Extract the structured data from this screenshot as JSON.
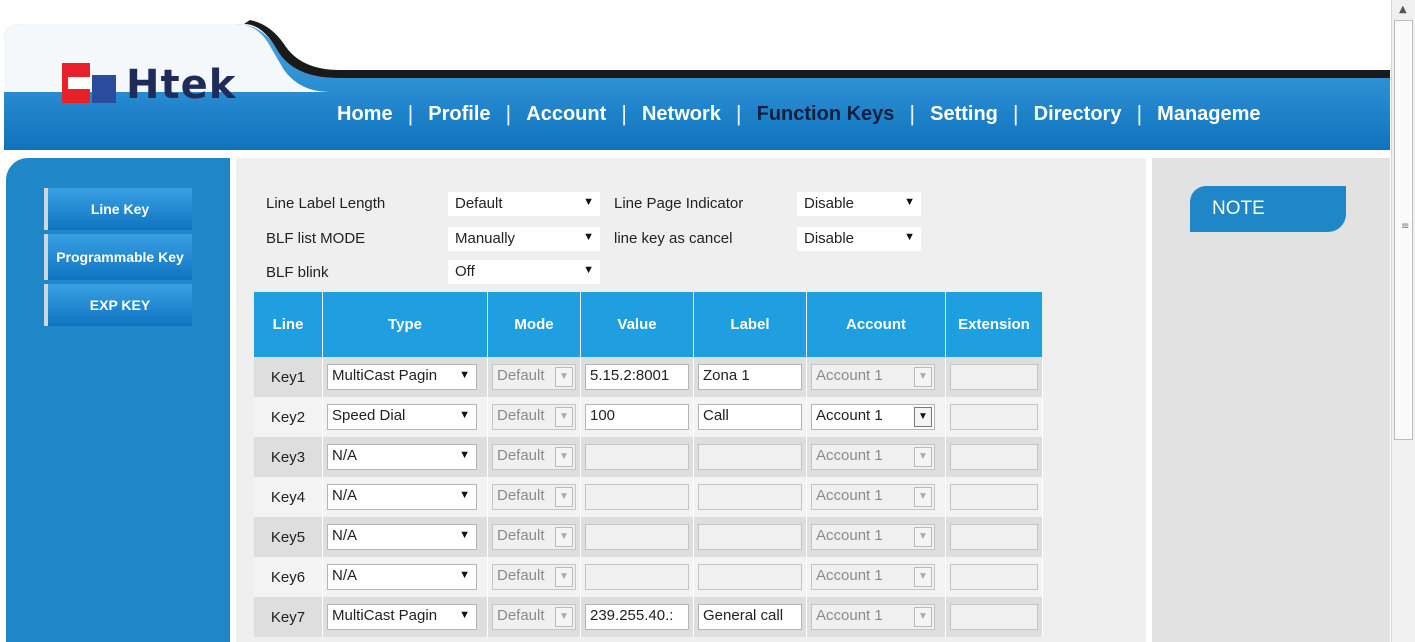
{
  "brand": {
    "logo_text": "Htek"
  },
  "nav": {
    "items": [
      "Home",
      "Profile",
      "Account",
      "Network",
      "Function Keys",
      "Setting",
      "Directory",
      "Manageme"
    ],
    "separator": "|",
    "active": "Function Keys"
  },
  "sidebar": {
    "items": [
      {
        "label": "Line Key"
      },
      {
        "label": "Programmable Key"
      },
      {
        "label": "EXP KEY"
      }
    ]
  },
  "settings": {
    "line_label_length": {
      "label": "Line Label Length",
      "value": "Default"
    },
    "line_page_indicator": {
      "label": "Line Page Indicator",
      "value": "Disable"
    },
    "blf_list_mode": {
      "label": "BLF list MODE",
      "value": "Manually"
    },
    "line_key_as_cancel": {
      "label": "line key as cancel",
      "value": "Disable"
    },
    "blf_blink": {
      "label": "BLF blink",
      "value": "Off"
    }
  },
  "table": {
    "headers": [
      "Line",
      "Type",
      "Mode",
      "Value",
      "Label",
      "Account",
      "Extension"
    ],
    "rows": [
      {
        "line": "Key1",
        "type": "MultiCast Pagin",
        "mode": "Default",
        "value": "5.15.2:8001",
        "label": "Zona 1",
        "account": "Account 1",
        "extension": ""
      },
      {
        "line": "Key2",
        "type": "Speed Dial",
        "mode": "Default",
        "value": "100",
        "label": "Call",
        "account": "Account 1",
        "extension": ""
      },
      {
        "line": "Key3",
        "type": "N/A",
        "mode": "Default",
        "value": "",
        "label": "",
        "account": "Account 1",
        "extension": ""
      },
      {
        "line": "Key4",
        "type": "N/A",
        "mode": "Default",
        "value": "",
        "label": "",
        "account": "Account 1",
        "extension": ""
      },
      {
        "line": "Key5",
        "type": "N/A",
        "mode": "Default",
        "value": "",
        "label": "",
        "account": "Account 1",
        "extension": ""
      },
      {
        "line": "Key6",
        "type": "N/A",
        "mode": "Default",
        "value": "",
        "label": "",
        "account": "Account 1",
        "extension": ""
      },
      {
        "line": "Key7",
        "type": "MultiCast Pagin",
        "mode": "Default",
        "value": "239.255.40.:",
        "label": "General call",
        "account": "Account 1",
        "extension": ""
      }
    ]
  },
  "note": {
    "title": "NOTE"
  },
  "colors": {
    "header_blue": "#1f86c7",
    "table_header": "#1f9ee0",
    "active_nav": "#0f1f3f"
  }
}
